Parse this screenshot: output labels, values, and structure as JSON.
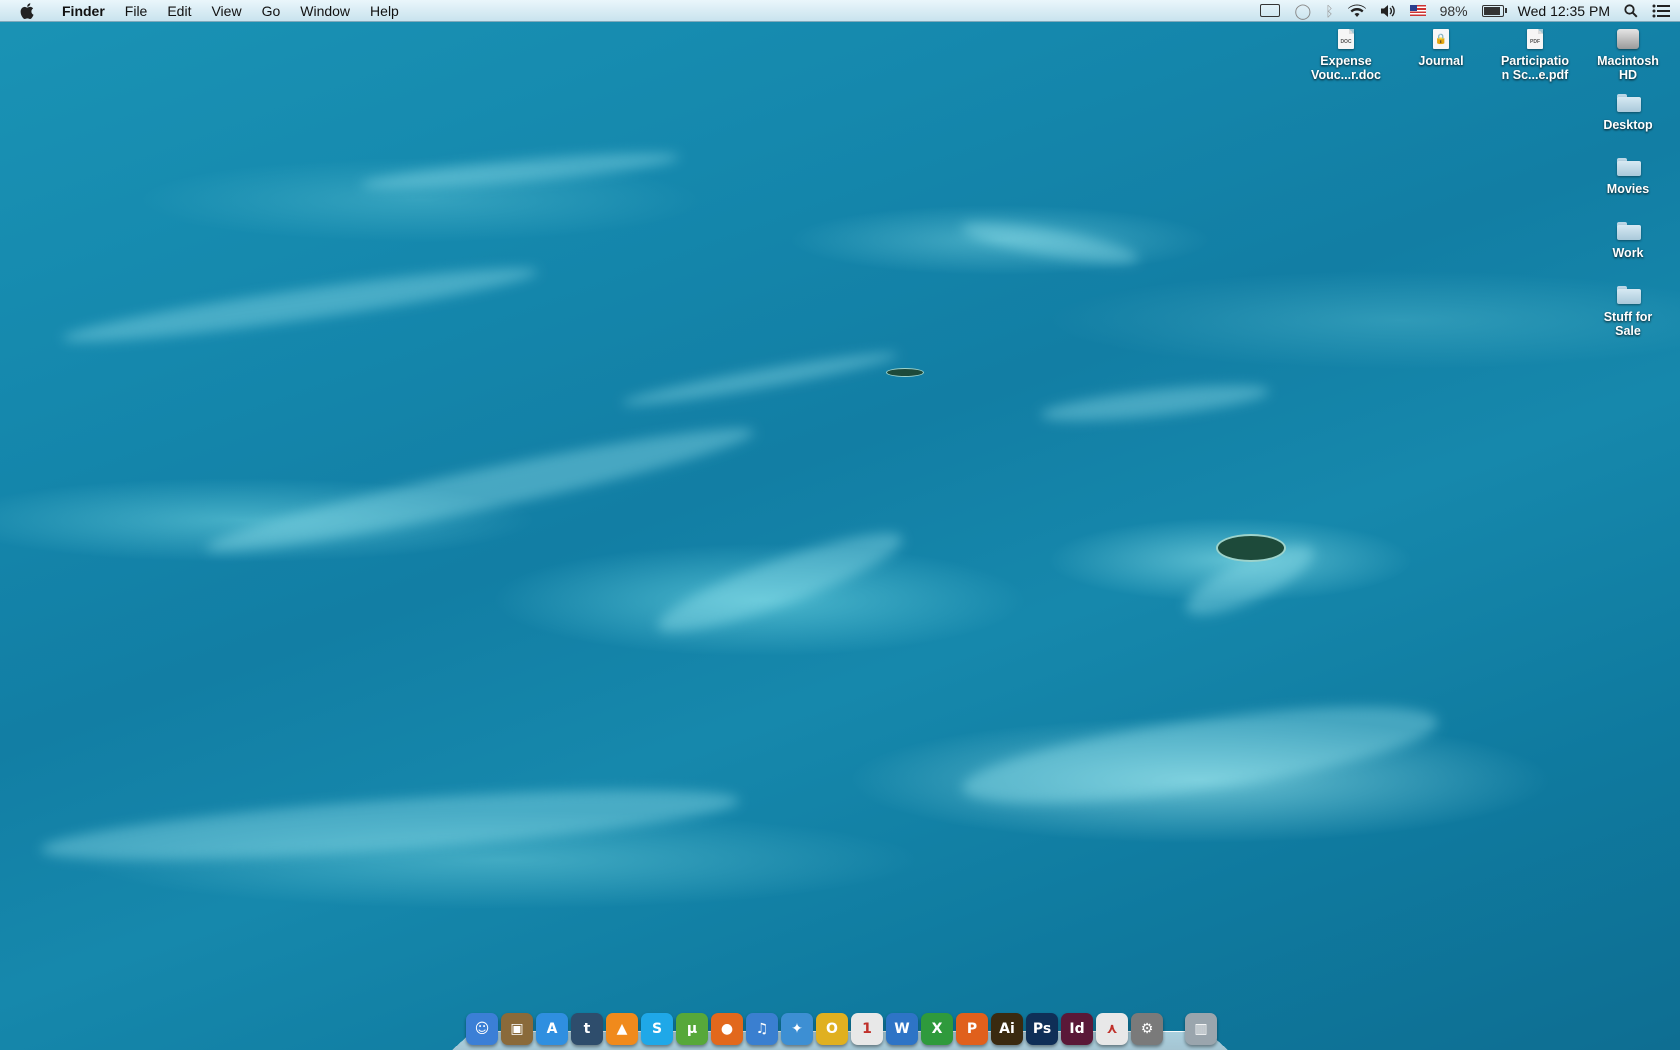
{
  "menubar": {
    "apple_icon": "apple-icon",
    "app_name": "Finder",
    "menus": [
      "File",
      "Edit",
      "View",
      "Go",
      "Window",
      "Help"
    ],
    "status": {
      "battery_percent": "98%",
      "battery_level": 0.98,
      "clock": "Wed 12:35 PM",
      "icons": [
        "display-mirroring-icon",
        "chat-status-icon",
        "bluetooth-icon",
        "wifi-icon",
        "volume-icon",
        "input-flag-icon",
        "battery-icon",
        "spotlight-icon",
        "notification-list-icon"
      ]
    }
  },
  "desktop_icons": [
    {
      "name": "expense-doc",
      "label": "Expense\nVouc...r.doc",
      "kind": "doc",
      "tag": "DOC"
    },
    {
      "name": "journal",
      "label": "Journal",
      "kind": "lock",
      "tag": ""
    },
    {
      "name": "participation-pdf",
      "label": "Participatio\nn Sc...e.pdf",
      "kind": "doc",
      "tag": "PDF"
    },
    {
      "name": "macintosh-hd",
      "label": "Macintosh\nHD",
      "kind": "hd",
      "tag": ""
    },
    {
      "name": "desktop-folder",
      "label": "Desktop",
      "kind": "folder",
      "tag": ""
    },
    {
      "name": "movies-folder",
      "label": "Movies",
      "kind": "folder",
      "tag": ""
    },
    {
      "name": "work-folder",
      "label": "Work",
      "kind": "folder",
      "tag": ""
    },
    {
      "name": "stuff-for-sale-folder",
      "label": "Stuff for\nSale",
      "kind": "folder",
      "tag": ""
    }
  ],
  "dock": {
    "apps": [
      {
        "name": "finder",
        "glyph": "☺",
        "color": "#3b7fd6"
      },
      {
        "name": "iphoto",
        "glyph": "▣",
        "color": "#8a6a3a"
      },
      {
        "name": "app-store",
        "glyph": "A",
        "color": "#2f8fe0"
      },
      {
        "name": "tumblr",
        "glyph": "t",
        "color": "#2e4d6c"
      },
      {
        "name": "vlc",
        "glyph": "▲",
        "color": "#f08a1c"
      },
      {
        "name": "skype",
        "glyph": "S",
        "color": "#1fa8e8"
      },
      {
        "name": "utorrent",
        "glyph": "µ",
        "color": "#57a83a"
      },
      {
        "name": "firefox",
        "glyph": "●",
        "color": "#e2681c"
      },
      {
        "name": "itunes",
        "glyph": "♫",
        "color": "#3a7fd0"
      },
      {
        "name": "safari",
        "glyph": "✦",
        "color": "#3d8fd3"
      },
      {
        "name": "opera",
        "glyph": "O",
        "color": "#e0b020"
      },
      {
        "name": "ical",
        "glyph": "1",
        "color": "#e8e8e8"
      },
      {
        "name": "word",
        "glyph": "W",
        "color": "#2e74c6"
      },
      {
        "name": "excel",
        "glyph": "X",
        "color": "#2f9a3c"
      },
      {
        "name": "powerpoint",
        "glyph": "P",
        "color": "#e0601c"
      },
      {
        "name": "illustrator",
        "glyph": "Ai",
        "color": "#3a2a10"
      },
      {
        "name": "photoshop",
        "glyph": "Ps",
        "color": "#0f2f57"
      },
      {
        "name": "indesign",
        "glyph": "Id",
        "color": "#5a1838"
      },
      {
        "name": "acrobat",
        "glyph": "⋏",
        "color": "#e8e8e8"
      },
      {
        "name": "system-preferences",
        "glyph": "⚙",
        "color": "#7a7a7a"
      },
      {
        "name": "trash",
        "glyph": "▥",
        "color": "#9aa5ad"
      }
    ]
  }
}
